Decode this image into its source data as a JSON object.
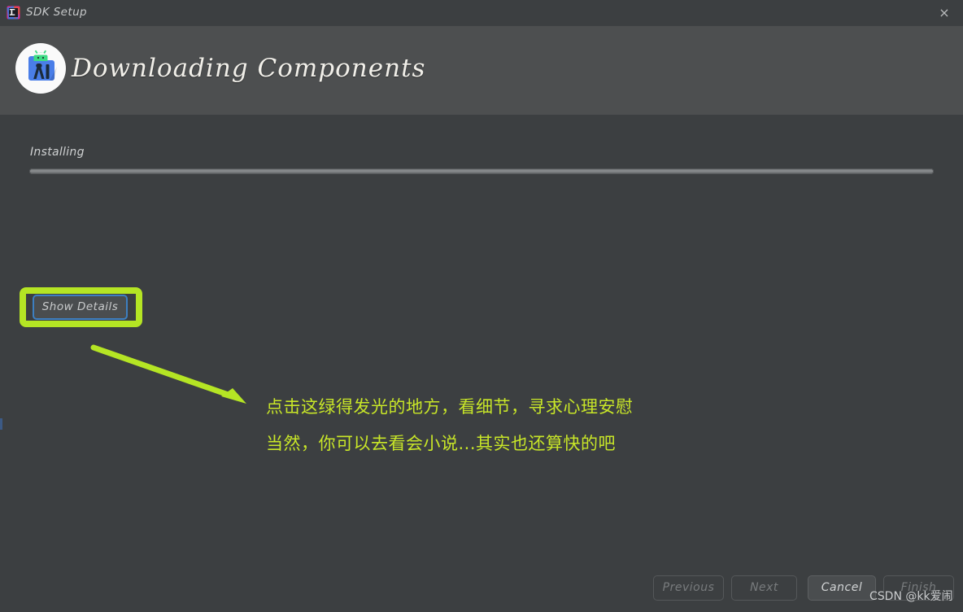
{
  "window": {
    "title": "SDK Setup",
    "app_icon": "jetbrains-icon",
    "close_label": "×"
  },
  "header": {
    "title": "Downloading Components",
    "logo_icon": "android-studio-icon"
  },
  "progress": {
    "status_label": "Installing",
    "percent": 0
  },
  "details": {
    "show_details_label": "Show Details",
    "highlight_color": "#b5e524",
    "focus_border_color": "#3d7fc1"
  },
  "annotation": {
    "arrow_icon": "arrow-pointing-right-down",
    "color": "#c8e628",
    "lines": [
      "点击这绿得发光的地方，看细节，寻求心理安慰",
      "当然，你可以去看会小说...其实也还算快的吧"
    ]
  },
  "footer": {
    "buttons": [
      {
        "label": "Previous",
        "state": "disabled"
      },
      {
        "label": "Next",
        "state": "disabled"
      },
      {
        "label": "Cancel",
        "state": "enabled"
      },
      {
        "label": "Finish",
        "state": "disabled"
      }
    ]
  },
  "watermark": {
    "text": "CSDN @kk爱闹"
  },
  "colors": {
    "background": "#3c3f41",
    "header_band": "#4d4f50",
    "accent_green": "#b5e524",
    "focus_blue": "#3d7fc1"
  }
}
